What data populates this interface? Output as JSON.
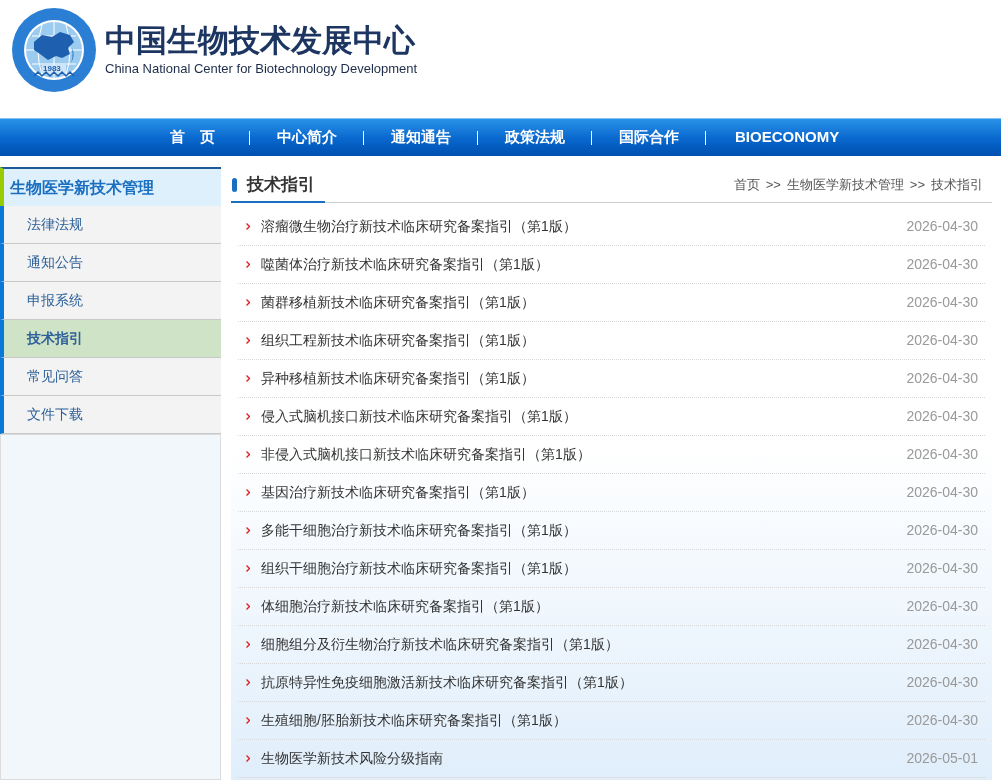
{
  "header": {
    "logo": {
      "year": "1983"
    },
    "title": "中国生物技术发展中心",
    "subtitle": "China National Center for Biotechnology Development"
  },
  "nav": {
    "items": [
      {
        "label": "首　页"
      },
      {
        "label": "中心简介"
      },
      {
        "label": "通知通告"
      },
      {
        "label": "政策法规"
      },
      {
        "label": "国际合作"
      },
      {
        "label": "BIOECONOMY"
      }
    ]
  },
  "sidebar": {
    "title": "生物医学新技术管理",
    "items": [
      {
        "label": "法律法规",
        "selected": false
      },
      {
        "label": "通知公告",
        "selected": false
      },
      {
        "label": "申报系统",
        "selected": false
      },
      {
        "label": "技术指引",
        "selected": true
      },
      {
        "label": "常见问答",
        "selected": false
      },
      {
        "label": "文件下载",
        "selected": false
      }
    ]
  },
  "content": {
    "title": "技术指引",
    "breadcrumb": [
      {
        "text": "首页",
        "separator": ">>"
      },
      {
        "text": "生物医学新技术管理",
        "separator": ">>"
      },
      {
        "text": "技术指引"
      }
    ],
    "rows": [
      {
        "title": "溶瘤微生物治疗新技术临床研究备案指引（第1版）",
        "date": "2026-04-30"
      },
      {
        "title": "噬菌体治疗新技术临床研究备案指引（第1版）",
        "date": "2026-04-30"
      },
      {
        "title": "菌群移植新技术临床研究备案指引（第1版）",
        "date": "2026-04-30"
      },
      {
        "title": "组织工程新技术临床研究备案指引（第1版）",
        "date": "2026-04-30"
      },
      {
        "title": "异种移植新技术临床研究备案指引（第1版）",
        "date": "2026-04-30"
      },
      {
        "title": "侵入式脑机接口新技术临床研究备案指引（第1版）",
        "date": "2026-04-30"
      },
      {
        "title": "非侵入式脑机接口新技术临床研究备案指引（第1版）",
        "date": "2026-04-30"
      },
      {
        "title": "基因治疗新技术临床研究备案指引（第1版）",
        "date": "2026-04-30"
      },
      {
        "title": "多能干细胞治疗新技术临床研究备案指引（第1版）",
        "date": "2026-04-30"
      },
      {
        "title": "组织干细胞治疗新技术临床研究备案指引（第1版）",
        "date": "2026-04-30"
      },
      {
        "title": "体细胞治疗新技术临床研究备案指引（第1版）",
        "date": "2026-04-30"
      },
      {
        "title": "细胞组分及衍生物治疗新技术临床研究备案指引（第1版）",
        "date": "2026-04-30"
      },
      {
        "title": "抗原特异性免疫细胞激活新技术临床研究备案指引（第1版）",
        "date": "2026-04-30"
      },
      {
        "title": "生殖细胞/胚胎新技术临床研究备案指引（第1版）",
        "date": "2026-04-30"
      },
      {
        "title": "生物医学新技术风险分级指南",
        "date": "2026-05-01"
      }
    ]
  }
}
